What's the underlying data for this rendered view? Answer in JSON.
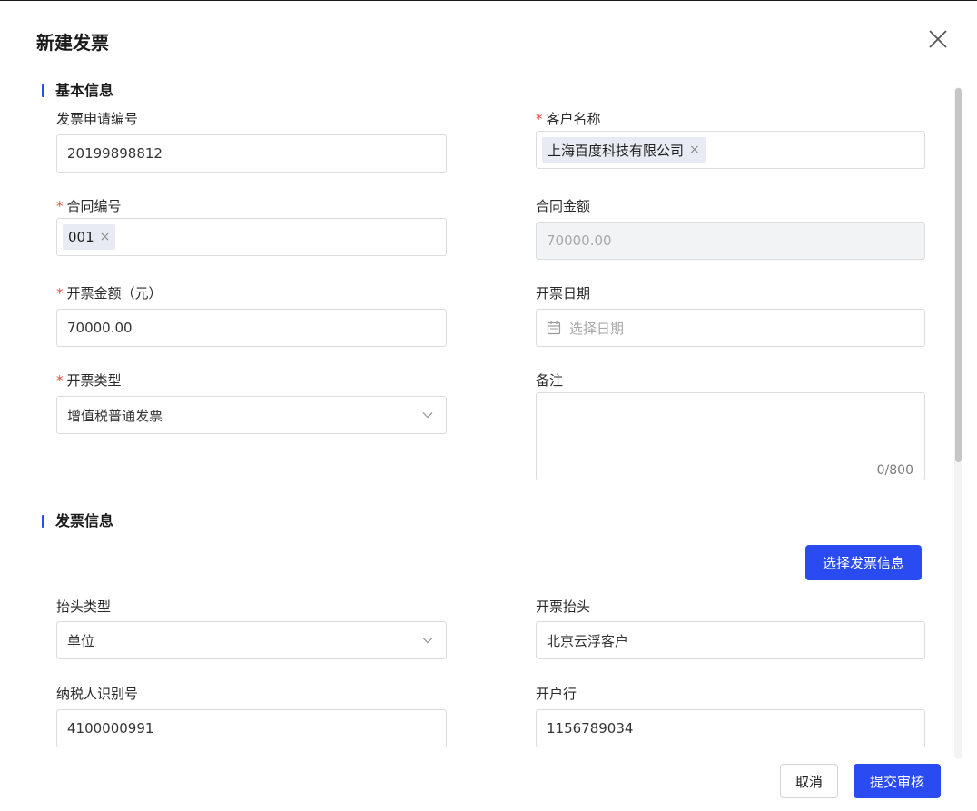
{
  "dialog": {
    "title": "新建发票"
  },
  "sections": {
    "basic": "基本信息",
    "invoice": "发票信息"
  },
  "fields": {
    "application_no": {
      "label": "发票申请编号",
      "value": "20199898812"
    },
    "customer_name": {
      "label": "客户名称",
      "tag": "上海百度科技有限公司",
      "required": true
    },
    "contract_no": {
      "label": "合同编号",
      "tag": "001",
      "required": true
    },
    "contract_amount": {
      "label": "合同金额",
      "value": "70000.00"
    },
    "invoice_amount": {
      "label": "开票金额（元）",
      "value": "70000.00",
      "required": true
    },
    "invoice_date": {
      "label": "开票日期",
      "placeholder": "选择日期"
    },
    "invoice_type": {
      "label": "开票类型",
      "value": "增值税普通发票",
      "required": true
    },
    "remark": {
      "label": "备注",
      "counter": "0/800"
    },
    "title_type": {
      "label": "抬头类型",
      "value": "单位"
    },
    "invoice_title": {
      "label": "开票抬头",
      "value": "北京云浮客户"
    },
    "taxpayer_id": {
      "label": "纳税人识别号",
      "value": "4100000991"
    },
    "bank": {
      "label": "开户行",
      "value": "1156789034"
    }
  },
  "buttons": {
    "select_invoice_info": "选择发票信息",
    "cancel": "取消",
    "submit": "提交审核"
  },
  "tag_remove_symbol": "×",
  "required_mark": "*",
  "icons": {
    "close": "close-icon",
    "calendar": "calendar-icon",
    "chevron": "chevron-down-icon"
  },
  "colors": {
    "primary": "#2b4bf2",
    "required": "#e5483d"
  }
}
